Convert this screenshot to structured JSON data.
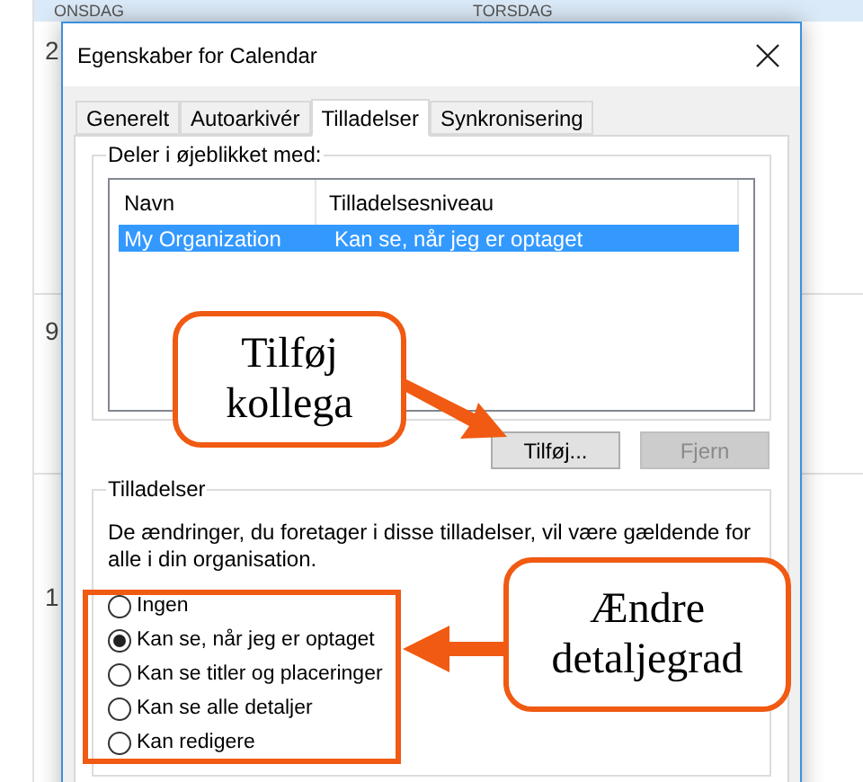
{
  "calendar": {
    "day_headers": [
      "ONSDAG",
      "TORSDAG"
    ],
    "day_numbers": [
      "2",
      "9",
      "1"
    ]
  },
  "dialog": {
    "title": "Egenskaber for Calendar",
    "tabs": [
      {
        "label": "Generelt",
        "selected": false
      },
      {
        "label": "Autoarkivér",
        "selected": false
      },
      {
        "label": "Tilladelser",
        "selected": true
      },
      {
        "label": "Synkronisering",
        "selected": false
      }
    ],
    "sharing_group": {
      "title": "Deler i øjeblikket med:",
      "columns": [
        "Navn",
        "Tilladelsesniveau"
      ],
      "rows": [
        {
          "name": "My Organization",
          "level": "Kan se, når jeg er optaget",
          "selected": true
        }
      ]
    },
    "buttons": [
      {
        "label": "Tilføj...",
        "disabled": false
      },
      {
        "label": "Fjern",
        "disabled": true
      }
    ],
    "permissions_group": {
      "title": "Tilladelser",
      "description": "De ændringer, du foretager i disse tilladelser, vil være gældende for alle i din organisation.",
      "options": [
        {
          "label": "Ingen",
          "selected": false
        },
        {
          "label": "Kan se, når jeg er optaget",
          "selected": true
        },
        {
          "label": "Kan se titler og placeringer",
          "selected": false
        },
        {
          "label": "Kan se alle detaljer",
          "selected": false
        },
        {
          "label": "Kan redigere",
          "selected": false
        }
      ]
    }
  },
  "callouts": [
    {
      "text": "Tilføj kollega"
    },
    {
      "text": "Ændre detaljegrad"
    }
  ]
}
